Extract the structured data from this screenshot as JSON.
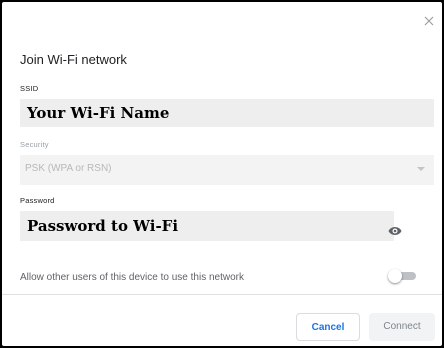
{
  "dialog": {
    "title": "Join Wi-Fi network",
    "ssid": {
      "label": "SSID",
      "value": "Your Wi-Fi Name"
    },
    "security": {
      "label": "Security",
      "selected": "PSK (WPA or RSN)"
    },
    "password": {
      "label": "Password",
      "value": "Password to Wi-Fi",
      "visibility_icon": "eye-icon"
    },
    "share": {
      "label": "Allow other users of this device to use this network",
      "enabled": false
    },
    "buttons": {
      "cancel": "Cancel",
      "connect": "Connect"
    },
    "close_icon": "close-icon",
    "colors": {
      "accent": "#1a73e8",
      "field_bg": "#eeeeee",
      "muted_text": "#9aa0a6"
    }
  }
}
